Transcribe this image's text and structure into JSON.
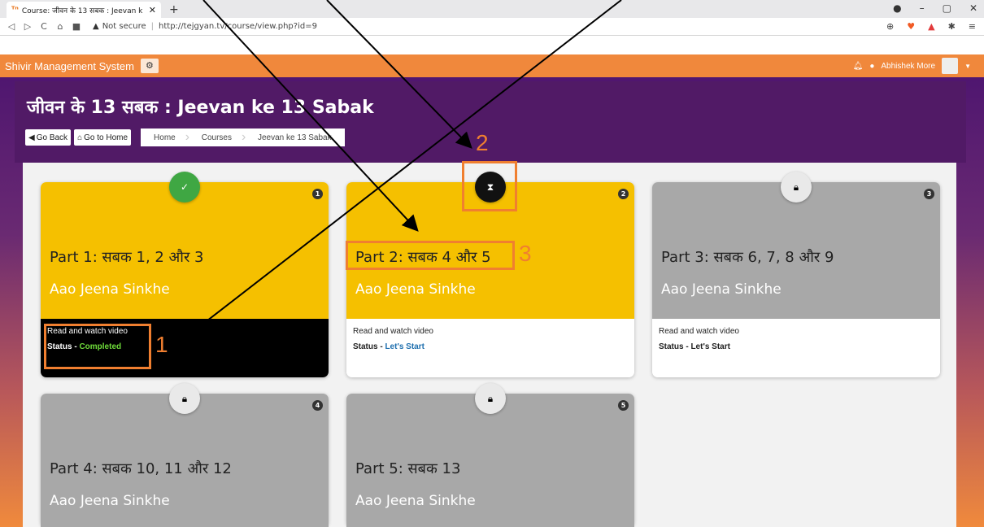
{
  "browser": {
    "tab_title": "Course: जीवन के 13 सबक : Jeevan k",
    "tab_favicon": "तेजज्ञान-favicon",
    "new_tab": "+",
    "security_label": "Not secure",
    "url": "http://tejgyan.tv/course/view.php?id=9"
  },
  "app": {
    "title": "Shivir Management System",
    "user_name": "Abhishek More"
  },
  "page": {
    "heading": "जीवन के 13 सबक : Jeevan ke 13 Sabak",
    "go_back": "Go Back",
    "go_home": "Go to Home",
    "breadcrumb": [
      "Home",
      "Courses",
      "Jeevan ke 13 Sabak"
    ]
  },
  "cards": [
    {
      "num": "1",
      "title": "Part 1: सबक 1, 2 और 3",
      "subtitle": "Aao Jeena Sinkhe",
      "line1": "Read and watch video",
      "status_prefix": "Status - ",
      "status": "Completed",
      "state": "completed",
      "icon": "check-icon"
    },
    {
      "num": "2",
      "title": "Part 2: सबक 4 और 5",
      "subtitle": "Aao Jeena Sinkhe",
      "line1": "Read and watch video",
      "status_prefix": "Status - ",
      "status": "Let's Start",
      "state": "in-progress",
      "icon": "hourglass-icon"
    },
    {
      "num": "3",
      "title": "Part 3: सबक 6, 7, 8 और 9",
      "subtitle": "Aao Jeena Sinkhe",
      "line1": "Read and watch video",
      "status_prefix": "Status - ",
      "status": "Let's Start",
      "state": "locked",
      "icon": "lock-icon"
    },
    {
      "num": "4",
      "title": "Part 4: सबक 10, 11 और 12",
      "subtitle": "Aao Jeena Sinkhe",
      "state": "locked",
      "icon": "lock-icon"
    },
    {
      "num": "5",
      "title": "Part 5: सबक 13",
      "subtitle": "Aao Jeena Sinkhe",
      "state": "locked",
      "icon": "lock-icon"
    }
  ],
  "annotations": [
    "1",
    "2",
    "3"
  ],
  "colors": {
    "accent": "#f07f30",
    "header": "#f0883c",
    "hero": "#511a66",
    "card_active": "#f5c000",
    "card_locked": "#a8a8a8"
  }
}
